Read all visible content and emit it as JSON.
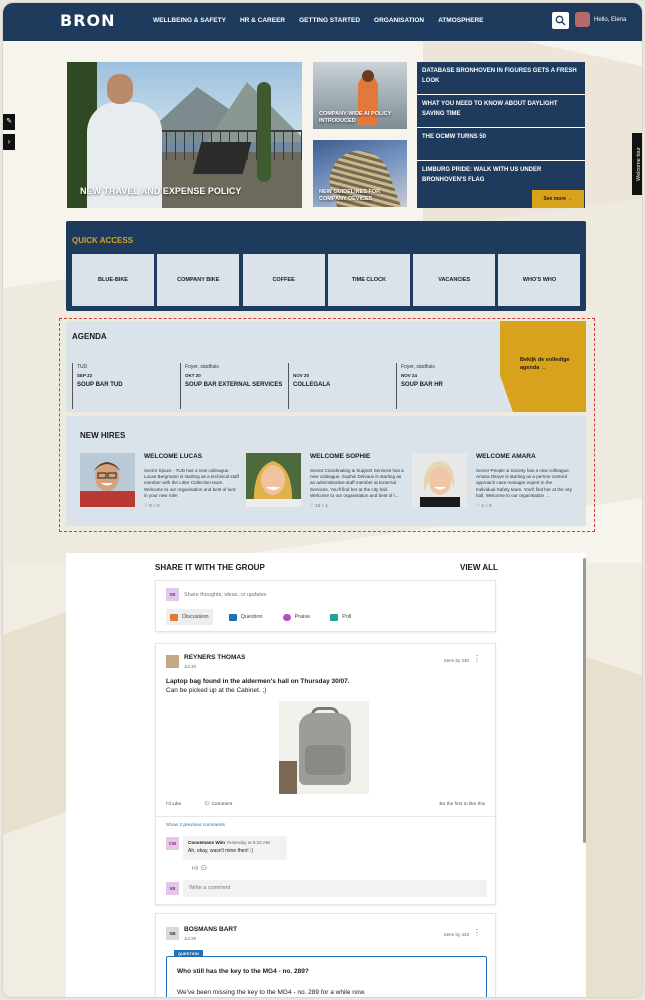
{
  "header": {
    "logo": "BRON",
    "nav": [
      "WELLBEING & SAFETY",
      "HR & CAREER",
      "GETTING STARTED",
      "ORGANISATION",
      "ATMOSPHERE"
    ],
    "greeting": "Hello, Elena",
    "welcome_tour": "Welcome tour"
  },
  "hero": {
    "main_caption": "NEW TRAVEL AND EXPENSE POLICY",
    "small1_caption": "COMPANY-WIDE AI POLICY INTRODUCED",
    "small2_caption": "NEW GUIDELINES FOR COMPANY DEVICES",
    "news": [
      "DATABASE BRONHOVEN IN FIGURES GETS A FRESH LOOK",
      "WHAT YOU NEED TO KNOW ABOUT DAYLIGHT SAVING TIME",
      "THE OCMW TURNS 50",
      "LIMBURG PRIDE: WALK WITH US UNDER BRONHOVEN'S FLAG"
    ],
    "see_more": "See more →"
  },
  "quick_access": {
    "title": "QUICK ACCESS",
    "tiles": [
      "BLUE-BIKE",
      "COMPANY BIKE",
      "COFFEE",
      "TIME CLOCK",
      "VACANCIES",
      "WHO'S WHO"
    ]
  },
  "agenda": {
    "title": "AGENDA",
    "items": [
      {
        "location": "TUD",
        "date": "SEP 22",
        "name": "SOUP BAR TUD"
      },
      {
        "location": "Foyer, stadhuis",
        "date": "OKT 20",
        "name": "SOUP BAR EXTERNAL SERVICES"
      },
      {
        "location": "",
        "date": "NOV 20",
        "name": "COLLEGALA"
      },
      {
        "location": "Foyer, stadhuis",
        "date": "NOV 24",
        "name": "SOUP BAR HR"
      }
    ],
    "cta": "Bekijk de volledige agenda →"
  },
  "new_hires": {
    "title": "NEW HIRES",
    "hires": [
      {
        "name": "WELCOME LUCAS",
        "text": "Sector Space - TUD has a new colleague. Lucas Bergmann is starting as a technical staff member with the Litter Collection team. Welcome to our organisation and best of luck in your new role!",
        "stats": "♡ 0 ○ 0"
      },
      {
        "name": "WELCOME SOPHIE",
        "text": "Sector Coordinating & Support Services has a new colleague. Sophie Delvaux is starting as an administrative staff member at External Services. You'll find her at the city hall. Welcome to our organisation and best of l...",
        "stats": "♡ 12 ○ 1"
      },
      {
        "name": "WELCOME AMARA",
        "text": "Sector People & Society has a new colleague. Amara Okoye is starting as a person-centred approach case manager expert in the Individual Safety team. You'll find her at the city hall. Welcome to our organisation ...",
        "stats": "♡ 1 ○ 0"
      }
    ]
  },
  "feed": {
    "title": "SHARE IT WITH THE GROUP",
    "view_all": "VIEW ALL",
    "composer": {
      "user_initials": "VE",
      "placeholder": "Share thoughts, ideas, or updates",
      "actions": [
        "Discussion",
        "Question",
        "Praise",
        "Poll"
      ]
    },
    "post1": {
      "author": "REYNERS THOMAS",
      "date": "Jul 30",
      "seen": "Seen by 330",
      "headline": "Laptop bag found in the aldermen's hall on Thursday 30/07.",
      "body": "Can be picked up at the Cabinet. ;)",
      "like": "Like",
      "comment": "Comment",
      "first_like": "Be the first to like this",
      "show_comments": "Show 2 previous comments",
      "comment_initials": "CW",
      "comment_author": "Coosemans Wim",
      "comment_time": "Yesterday at 9:22 AM",
      "comment_text": "Ah, okay, wasn't mine then! :)",
      "write_placeholder": "Write a comment",
      "writer_initials": "VE"
    },
    "post2": {
      "author_initials": "SB",
      "author": "BOSMANS BART",
      "date": "Jul 29",
      "seen": "Seen by 423",
      "badge": "QUESTION",
      "question": "Who still has the key to the MG4 - no. 289?",
      "body": "We've been missing the key to the MG4 - no. 289 for a while now."
    }
  },
  "colors": {
    "navy": "#1e3a5c",
    "gold": "#d9a21c",
    "tile": "#dbe3ea",
    "link": "#1f6fb5"
  }
}
